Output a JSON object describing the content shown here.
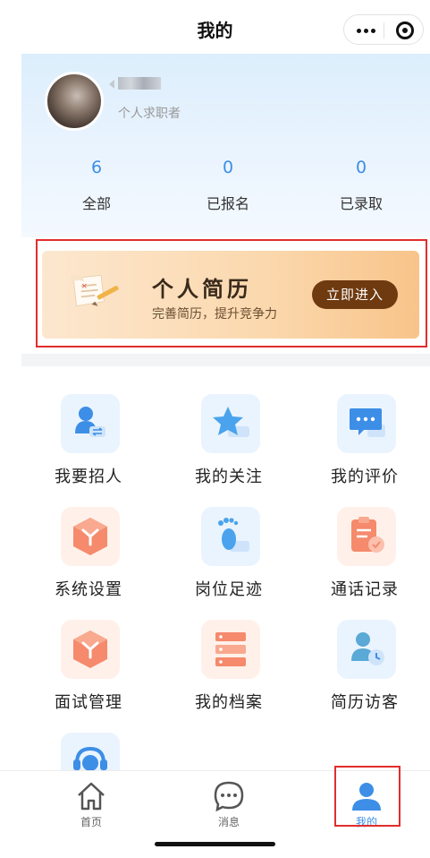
{
  "nav": {
    "title": "我的"
  },
  "profile": {
    "role": "个人求职者",
    "stats": [
      {
        "value": "6",
        "label": "全部"
      },
      {
        "value": "0",
        "label": "已报名"
      },
      {
        "value": "0",
        "label": "已录取"
      }
    ]
  },
  "banner": {
    "title": "个人简历",
    "subtitle": "完善简历，提升竞争力",
    "button": "立即进入"
  },
  "grid": [
    {
      "label": "我要招人",
      "icon": "recruit-icon"
    },
    {
      "label": "我的关注",
      "icon": "star-icon"
    },
    {
      "label": "我的评价",
      "icon": "comment-icon"
    },
    {
      "label": "系统设置",
      "icon": "cube-icon"
    },
    {
      "label": "岗位足迹",
      "icon": "footprint-icon"
    },
    {
      "label": "通话记录",
      "icon": "clipboard-icon"
    },
    {
      "label": "面试管理",
      "icon": "cube-icon"
    },
    {
      "label": "我的档案",
      "icon": "server-icon"
    },
    {
      "label": "简历访客",
      "icon": "visitor-icon"
    },
    {
      "label": "",
      "icon": "headset-icon"
    }
  ],
  "tabbar": {
    "items": [
      {
        "label": "首页",
        "icon": "home-icon"
      },
      {
        "label": "消息",
        "icon": "message-icon"
      },
      {
        "label": "我的",
        "icon": "user-icon"
      }
    ],
    "active_color": "#3d8ee6"
  },
  "colors": {
    "accent": "#3d8ee6",
    "banner_button": "#6f3a10",
    "highlight": "#e22d2d"
  }
}
